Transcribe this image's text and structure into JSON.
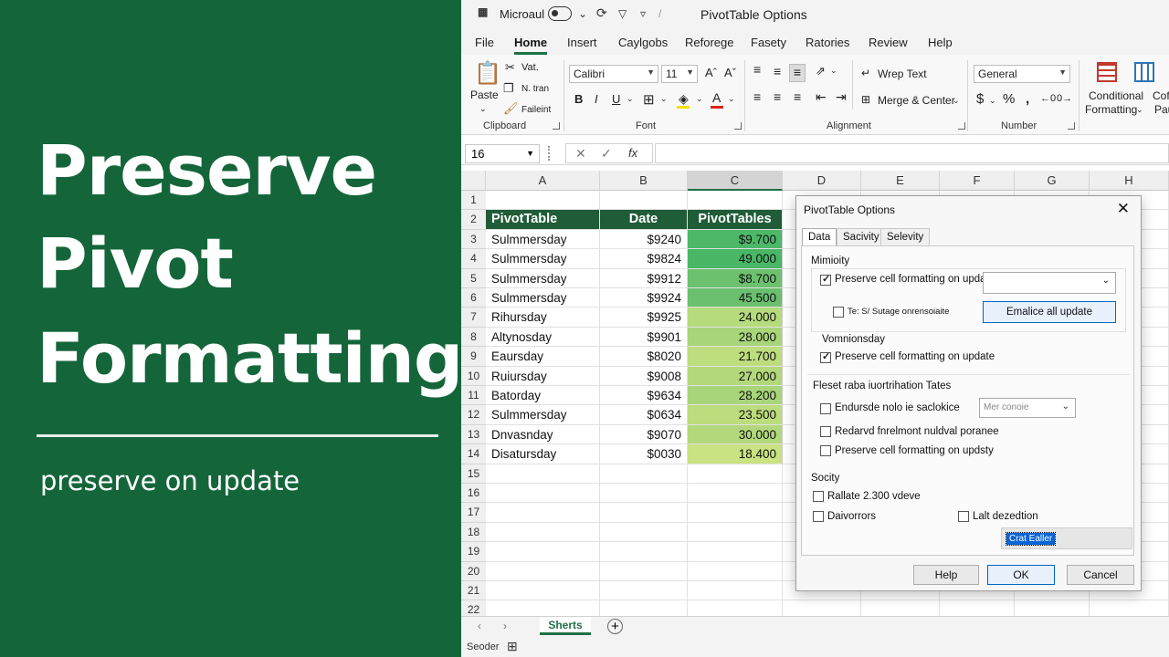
{
  "hero": {
    "line1": "Preserve",
    "line2": "Pivot",
    "line3": "Formatting",
    "subtitle": "preserve on update"
  },
  "titlebar": {
    "app": "Microaul",
    "window_title": "PivotTable Options"
  },
  "tabs": [
    "File",
    "Home",
    "Insert",
    "Caylgobs",
    "Reforege",
    "Fasety",
    "Ratories",
    "Review",
    "Help"
  ],
  "ribbon": {
    "paste": "Paste",
    "cut": "Vat.",
    "copy": "N. tran",
    "format_painter": "Faileint",
    "clipboard": "Clipboard",
    "font_name": "Calibri",
    "font_size": "11",
    "font": "Font",
    "wrap_text": "Wrep Text",
    "merge_center": "Merge & Center",
    "alignment": "Alignment",
    "number_format": "General",
    "number": "Number",
    "conditional": "Conditional",
    "formatting": "Formatting",
    "cofala": "Cofala",
    "pau": "Pau"
  },
  "formula_bar": {
    "name_box": "16",
    "fx": "fx"
  },
  "columns": [
    "A",
    "B",
    "C",
    "D",
    "E",
    "F",
    "G",
    "H"
  ],
  "rows": [
    "1",
    "2",
    "3",
    "4",
    "5",
    "6",
    "7",
    "8",
    "9",
    "10",
    "11",
    "12",
    "13",
    "14",
    "15",
    "16",
    "17",
    "18",
    "19",
    "20",
    "21",
    "22"
  ],
  "table": {
    "headers": [
      "PivotTable",
      "Date",
      "PivotTables"
    ],
    "rows": [
      [
        "Sulmmersday",
        "$9240",
        "$9.700"
      ],
      [
        "Sulmmersday",
        "$9824",
        "49.000"
      ],
      [
        "Sulmmersday",
        "$9912",
        "$8.700"
      ],
      [
        "Sulmmersday",
        "$9924",
        "45.500"
      ],
      [
        "Rihursday",
        "$9925",
        "24.000"
      ],
      [
        "Altynosday",
        "$9901",
        "28.000"
      ],
      [
        "Eaursday",
        "$8020",
        "21.700"
      ],
      [
        "Ruiursday",
        "$9008",
        "27.000"
      ],
      [
        "Batorday",
        "$9634",
        "28.200"
      ],
      [
        "Sulmmersday",
        "$0634",
        "23.500"
      ],
      [
        "Dnvasnday",
        "$9070",
        "30.000"
      ],
      [
        "Disatursday",
        "$0030",
        "18.400"
      ]
    ],
    "colors": [
      "#4cb868",
      "#49b765",
      "#6cc16e",
      "#6ac06e",
      "#b6db7c",
      "#a8d579",
      "#bddd7e",
      "#b3d87b",
      "#a9d57a",
      "#bcdc7d",
      "#b2d87b",
      "#c9e282"
    ]
  },
  "sheet": {
    "tab": "Sherts",
    "status": "Seoder"
  },
  "dialog": {
    "title": "PivotTable Options",
    "tabs": [
      "Data",
      "Sacivity",
      "Selevity"
    ],
    "sec1": "Mimioity",
    "opt1": "Preserve cell formatting on update",
    "opt2": "Te: S/ Sutage onrensoiaite",
    "enable_btn": "Emalice all update",
    "sec2": "Vomnionsday",
    "opt3": "Preserve cell formatting on update",
    "sec3": "Fleset raba iuortrihation Tates",
    "opt4": "Endursde nolo ie saclokice",
    "opt4_combo": "Mer conoie",
    "opt5": "Redarvd fnrelmont nuldval poranee",
    "opt6": "Preserve cell formatting on updsty",
    "sec4": "Socity",
    "opt7": "Rallate 2.300 vdeve",
    "opt8": "Daivorrors",
    "opt9": "Lalt dezedtion",
    "field_val": "Crat Ealler",
    "help": "Help",
    "ok": "OK",
    "cancel": "Cancel"
  }
}
